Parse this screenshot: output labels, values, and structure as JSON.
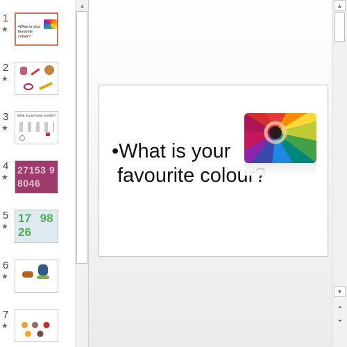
{
  "thumbnails": [
    {
      "number": "1",
      "star": "★",
      "text": "•What is your favourite colour?"
    },
    {
      "number": "2",
      "star": "★"
    },
    {
      "number": "3",
      "star": "★",
      "text": "What is your lucky number?"
    },
    {
      "number": "4",
      "star": "★",
      "text": "27153 98046"
    },
    {
      "number": "5",
      "star": "★",
      "text": "17 98 26"
    },
    {
      "number": "6",
      "star": "★"
    },
    {
      "number": "7",
      "star": "★"
    }
  ],
  "slide": {
    "line1": "•What is your",
    "line2": "favourite colour?"
  },
  "scrollbars": {
    "up_arrow": "▲",
    "down_arrow": "▼",
    "prev_slide": "⏶",
    "next_slide": "⏷"
  },
  "colors": {
    "active_number": "#c0392b",
    "active_border": "#e07050",
    "thumb4_bg": "#a0396c"
  }
}
